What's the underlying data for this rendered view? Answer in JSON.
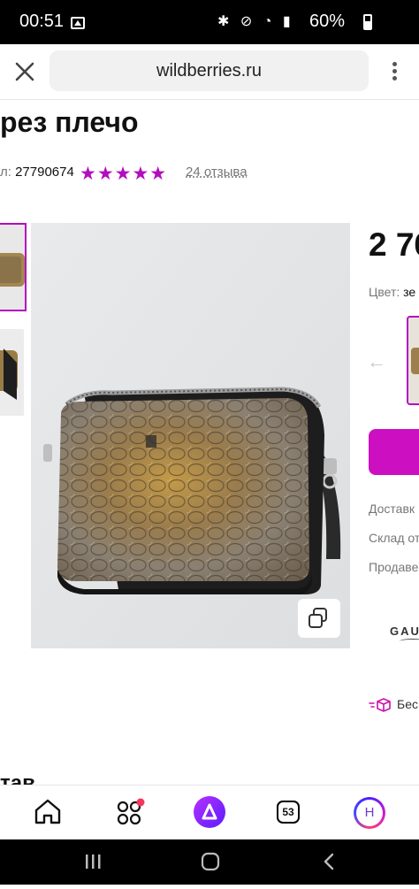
{
  "status_bar": {
    "time": "00:51",
    "battery": "60%",
    "icons": [
      "gallery-icon",
      "bluetooth-icon",
      "mute-icon",
      "wifi-icon",
      "volte-icon",
      "signal-icon",
      "battery-icon"
    ]
  },
  "browser": {
    "url": "wildberries.ru",
    "icons": [
      "close-icon",
      "more-vert-icon"
    ]
  },
  "product": {
    "title": "рез плечо",
    "article_label": "л:",
    "article_number": "27790674",
    "rating": 5,
    "stars": "★★★★★",
    "reviews": "24 отзыва",
    "price": "2 76",
    "color_label": "Цвет:",
    "color_value": "зе",
    "delivery_label": "Доставк",
    "warehouse_label": "Склад от",
    "seller_label": "Продаве",
    "seller_logo": "GAU",
    "free_label": "Бес",
    "composition_heading": "тав"
  },
  "bottom_nav": {
    "cart_count": "53",
    "profile_initial": "Н",
    "icons": [
      "home-icon",
      "catalog-icon",
      "alice-icon",
      "cart-icon",
      "profile-icon"
    ]
  },
  "colors": {
    "accent": "#cb11ab",
    "stars": "#b20dbf",
    "cart_button": "#cc0fc0",
    "badge_dot": "#f5365c"
  }
}
